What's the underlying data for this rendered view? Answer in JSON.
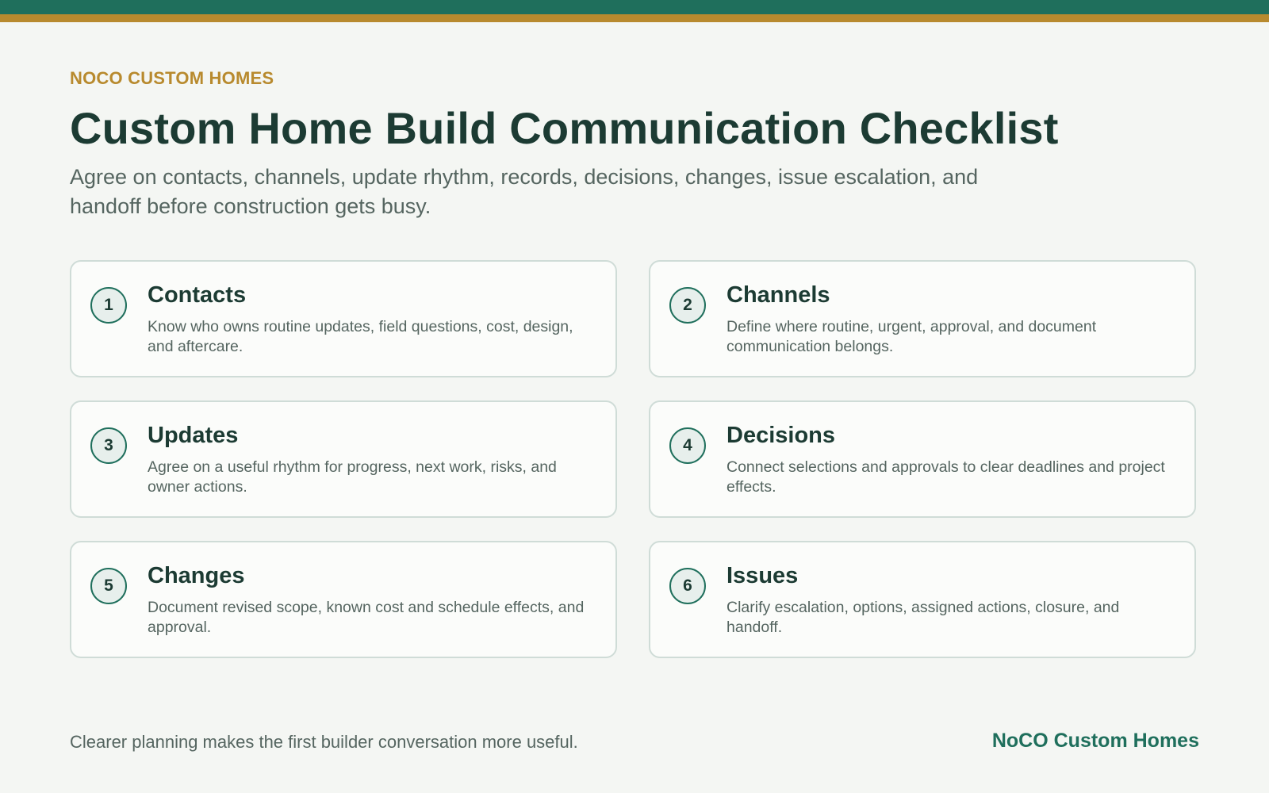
{
  "brand": {
    "eyebrow": "NOCO CUSTOM HOMES",
    "footer_name": "NoCO Custom Homes"
  },
  "header": {
    "title": "Custom Home Build Communication Checklist",
    "subtitle": "Agree on contacts, channels, update rhythm, records, decisions, changes, issue escalation, and handoff before construction gets busy."
  },
  "checklist": [
    {
      "number": "1",
      "title": "Contacts",
      "text": "Know who owns routine updates, field questions, cost, design, and aftercare."
    },
    {
      "number": "2",
      "title": "Channels",
      "text": "Define where routine, urgent, approval, and document communication belongs."
    },
    {
      "number": "3",
      "title": "Updates",
      "text": "Agree on a useful rhythm for progress, next work, risks, and owner actions."
    },
    {
      "number": "4",
      "title": "Decisions",
      "text": "Connect selections and approvals to clear deadlines and project effects."
    },
    {
      "number": "5",
      "title": "Changes",
      "text": "Document revised scope, known cost and schedule effects, and approval."
    },
    {
      "number": "6",
      "title": "Issues",
      "text": "Clarify escalation, options, assigned actions, closure, and handoff."
    }
  ],
  "footer": {
    "note": "Clearer planning makes the first builder conversation more useful."
  },
  "colors": {
    "primary_green": "#1f6f5c",
    "accent_gold": "#b88a2e",
    "heading_dark": "#1c3b33",
    "body_gray": "#556560",
    "background": "#f4f6f3"
  }
}
